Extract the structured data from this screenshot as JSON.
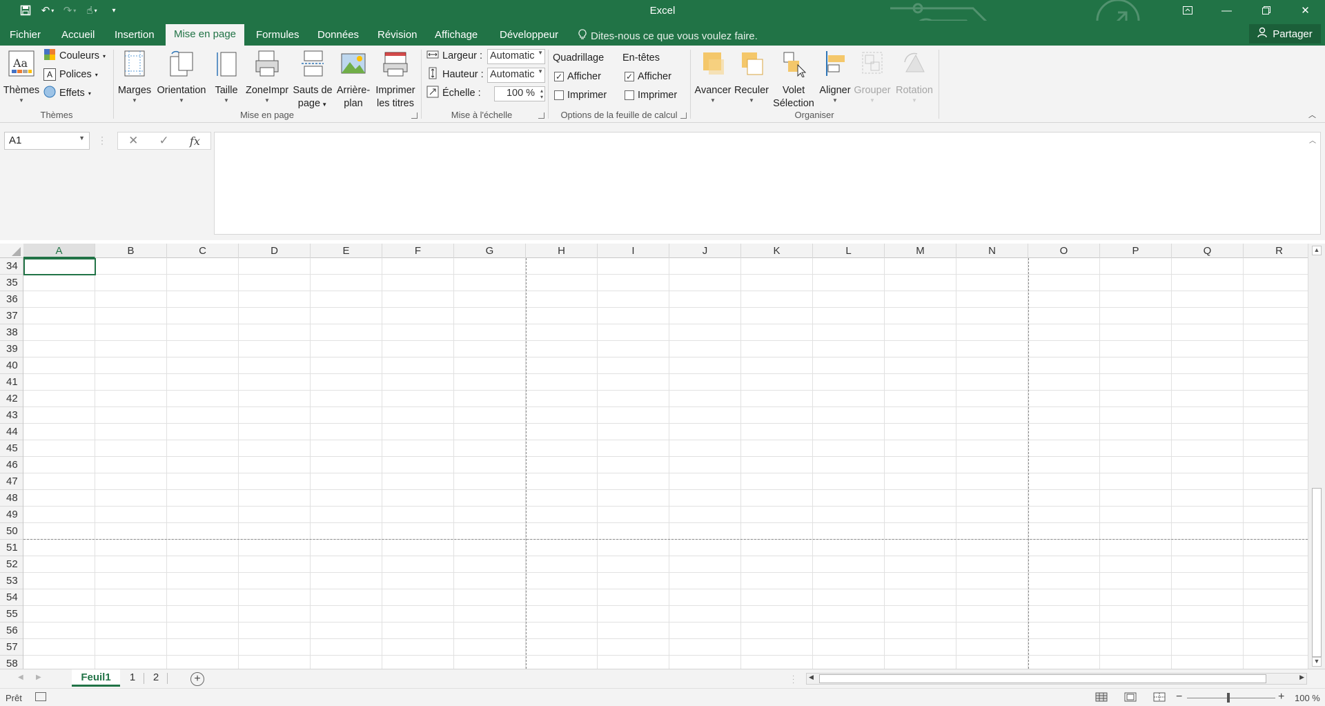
{
  "app": {
    "title": "Excel"
  },
  "qat": {
    "save": "save-icon",
    "undo": "undo-icon",
    "redo": "redo-icon",
    "touch": "touch-mode-icon",
    "customize": "customize-qat-icon"
  },
  "tabs": [
    {
      "label": "Fichier",
      "active": false
    },
    {
      "label": "Accueil",
      "active": false
    },
    {
      "label": "Insertion",
      "active": false
    },
    {
      "label": "Mise en page",
      "active": true
    },
    {
      "label": "Formules",
      "active": false
    },
    {
      "label": "Données",
      "active": false
    },
    {
      "label": "Révision",
      "active": false
    },
    {
      "label": "Affichage",
      "active": false
    },
    {
      "label": "Développeur",
      "active": false
    }
  ],
  "tellme": "Dites-nous ce que vous voulez faire.",
  "share": "Partager",
  "ribbon": {
    "themes": {
      "label": "Thèmes",
      "button": "Thèmes",
      "couleurs": "Couleurs",
      "polices": "Polices",
      "effets": "Effets"
    },
    "page_setup": {
      "label": "Mise en page",
      "marges": "Marges",
      "orientation": "Orientation",
      "taille": "Taille",
      "zone": "ZoneImpr",
      "sauts1": "Sauts de",
      "sauts2": "page",
      "arriere1": "Arrière-",
      "arriere2": "plan",
      "imprimer1": "Imprimer",
      "imprimer2": "les titres"
    },
    "scale": {
      "label": "Mise à l'échelle",
      "largeur": "Largeur :",
      "largeur_value": "Automatic",
      "hauteur": "Hauteur :",
      "hauteur_value": "Automatic",
      "echelle": "Échelle :",
      "echelle_value": "100 %"
    },
    "sheet_options": {
      "label": "Options de la feuille de calcul",
      "quadrillage": "Quadrillage",
      "entetes": "En-têtes",
      "afficher": "Afficher",
      "imprimer": "Imprimer"
    },
    "arrange": {
      "label": "Organiser",
      "avancer": "Avancer",
      "reculer": "Reculer",
      "volet1": "Volet",
      "volet2": "Sélection",
      "aligner": "Aligner",
      "grouper": "Grouper",
      "rotation": "Rotation"
    }
  },
  "formula_bar": {
    "name_box": "A1",
    "fx": "fx",
    "value": ""
  },
  "columns": [
    "A",
    "B",
    "C",
    "D",
    "E",
    "F",
    "G",
    "H",
    "I",
    "J",
    "K",
    "L",
    "M",
    "N",
    "O",
    "P",
    "Q",
    "R"
  ],
  "rows": [
    "34",
    "35",
    "36",
    "37",
    "38",
    "39",
    "40",
    "41",
    "42",
    "43",
    "44",
    "45",
    "46",
    "47",
    "48",
    "49",
    "50",
    "51",
    "52",
    "53",
    "54",
    "55",
    "56",
    "57",
    "58"
  ],
  "sheets": [
    {
      "label": "Feuil1",
      "active": true
    },
    {
      "label": "1",
      "active": false
    },
    {
      "label": "2",
      "active": false
    }
  ],
  "status": {
    "ready": "Prêt",
    "zoom": "100 %"
  },
  "colors": {
    "accent": "#217346",
    "ribbon_bg": "#f3f3f3"
  }
}
